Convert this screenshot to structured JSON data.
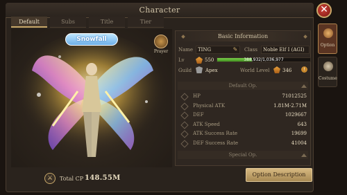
{
  "window": {
    "title": "Character"
  },
  "tabs": [
    "Default",
    "Subs",
    "Title",
    "Tier"
  ],
  "character": {
    "badge": "Snowfall",
    "prayer_label": "Prayer"
  },
  "combat_power": {
    "label": "Total CP",
    "value": "148.55M"
  },
  "basic_info": {
    "header": "Basic Information",
    "name_label": "Name",
    "name_value": "TING",
    "class_label": "Class",
    "class_value": "Noble Elf I (AGI)",
    "lv_label": "Lv",
    "lv_value": "550",
    "exp_text": "388,932/1,036,977",
    "exp_fraction": 0.375,
    "guild_label": "Guild",
    "guild_value": "Apex",
    "world_level_label": "World Level",
    "world_level_value": "346",
    "info_icon": "!"
  },
  "default_op": {
    "header": "Default Op.",
    "stats": [
      {
        "name": "HP",
        "value": "71012525"
      },
      {
        "name": "Physical ATK",
        "value": "1.81M-2.71M"
      },
      {
        "name": "DEF",
        "value": "1029667"
      },
      {
        "name": "ATK Speed",
        "value": "643"
      },
      {
        "name": "ATK Success Rate",
        "value": "19699"
      },
      {
        "name": "DEF Success Rate",
        "value": "41004"
      }
    ]
  },
  "special_op": {
    "header": "Special Op."
  },
  "buttons": {
    "option_description": "Option Description",
    "close": "✕"
  },
  "side_menu": [
    {
      "label": "Option",
      "icon": "option-icon",
      "active": true
    },
    {
      "label": "Costume",
      "icon": "costume-icon",
      "active": false
    }
  ],
  "colors": {
    "accent": "#c9a96a",
    "exp_bar": "#5aaf2f",
    "close": "#c0392b"
  }
}
